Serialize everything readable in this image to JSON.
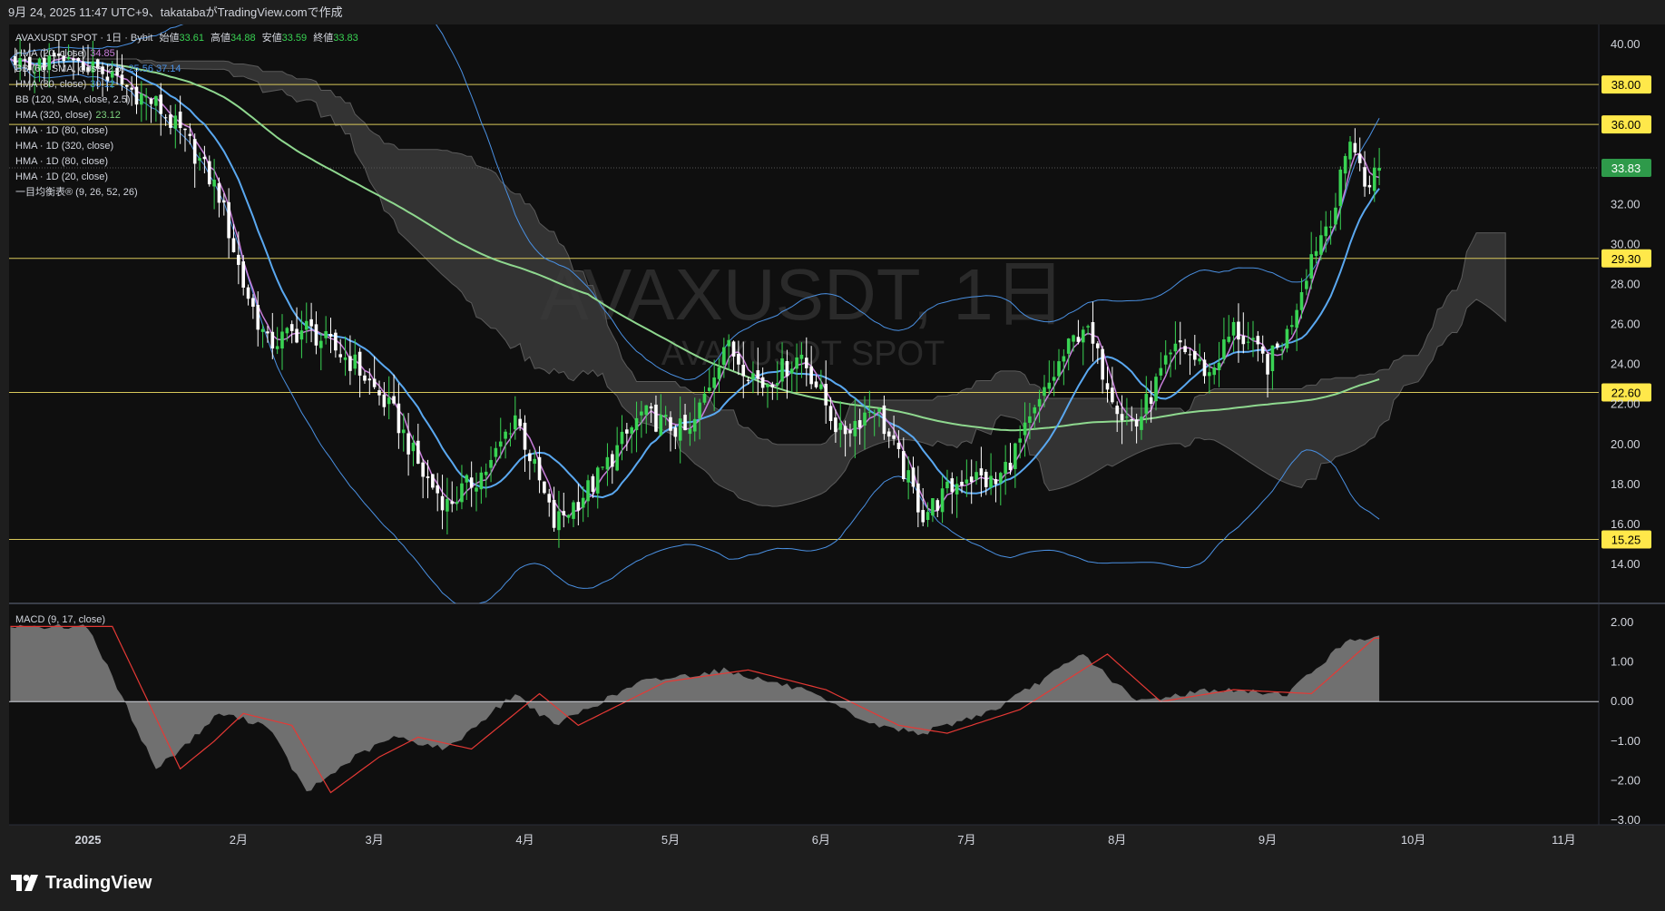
{
  "header": {
    "caption": "9月 24, 2025 11:47 UTC+9、takatabaがTradingView.comで作成"
  },
  "legend": {
    "symbol_line": {
      "label": "AVAXUSDT SPOT · 1日 · Bybit",
      "open_label": "始値",
      "open": "33.61",
      "high_label": "高値",
      "high": "34.88",
      "low_label": "安値",
      "low": "33.59",
      "close_label": "終値",
      "close": "33.83"
    },
    "indicators": [
      {
        "text": "HMA (20, close)",
        "value": "34.85",
        "color": "#c77dd9"
      },
      {
        "text": "BB (60, SMA, close, 2.5)",
        "value": "25.56  37.14",
        "color": "#4a90e2"
      },
      {
        "text": "HMA (80, close)",
        "value": "30.12",
        "color": "#4a90e2"
      },
      {
        "text": "BB (120, SMA, close, 2.5)",
        "value": "",
        "color": ""
      },
      {
        "text": "HMA (320, close)",
        "value": "23.12",
        "color": "#7ed37e"
      },
      {
        "text": "HMA · 1D (80, close)",
        "value": "",
        "color": ""
      },
      {
        "text": "HMA · 1D (320, close)",
        "value": "",
        "color": ""
      },
      {
        "text": "HMA · 1D (80, close)",
        "value": "",
        "color": ""
      },
      {
        "text": "HMA · 1D (20, close)",
        "value": "",
        "color": ""
      },
      {
        "text": "一目均衡表® (9, 26, 52, 26)",
        "value": "",
        "color": ""
      }
    ]
  },
  "watermark": {
    "main": "AVAXUSDT, 1日",
    "sub": "AVAXUSDT SPOT"
  },
  "price_axis": {
    "ticks": [
      "40.00",
      "32.00",
      "30.00",
      "28.00",
      "26.00",
      "24.00",
      "22.00",
      "20.00",
      "18.00",
      "16.00",
      "14.00"
    ]
  },
  "levels": [
    "38.00",
    "36.00",
    "29.30",
    "22.60",
    "15.25"
  ],
  "last_price": "33.83",
  "macd_pane": {
    "title": "MACD (9, 17, close)",
    "ticks": [
      "2.00",
      "1.00",
      "0.00",
      "−1.00",
      "−2.00",
      "−3.00"
    ]
  },
  "time_axis": {
    "labels": [
      "2025",
      "2月",
      "3月",
      "4月",
      "5月",
      "6月",
      "7月",
      "8月",
      "9月",
      "10月",
      "11月"
    ]
  },
  "footer": {
    "brand": "TradingView"
  },
  "colors": {
    "up": "#39d353",
    "down": "#ffffff",
    "level_line": "#d8c85a",
    "hma20": "#c77dd9",
    "hma80": "#5aa8f0",
    "hma320": "#8fd88f",
    "bb": "#4a90e2",
    "cloud": "#3a3a3a",
    "macd": "#e53935",
    "histogram": "#888888",
    "last_price_bg": "#2e9a4a"
  },
  "chart_data": [
    {
      "type": "candlestick",
      "title": "AVAXUSDT, 1日",
      "y_axis_ticks": [
        14,
        16,
        18,
        20,
        22,
        24,
        26,
        28,
        30,
        32,
        40
      ],
      "ylim": [
        13,
        41
      ],
      "x_labels": [
        "2025",
        "2月",
        "3月",
        "4月",
        "5月",
        "6月",
        "7月",
        "8月",
        "9月",
        "10月",
        "11月"
      ],
      "horizontal_levels": [
        38.0,
        36.0,
        29.3,
        22.6,
        15.25
      ],
      "last_close": 33.83,
      "last_bar": {
        "open": 33.61,
        "high": 34.88,
        "low": 33.59,
        "close": 33.83
      },
      "close_path": [
        {
          "date": "2025-01-01",
          "close": 39.0
        },
        {
          "date": "2025-01-15",
          "close": 37.0
        },
        {
          "date": "2025-01-22",
          "close": 35.0
        },
        {
          "date": "2025-01-28",
          "close": 32.5
        },
        {
          "date": "2025-02-02",
          "close": 28.0
        },
        {
          "date": "2025-02-07",
          "close": 25.0
        },
        {
          "date": "2025-02-15",
          "close": 25.8
        },
        {
          "date": "2025-02-25",
          "close": 24.0
        },
        {
          "date": "2025-03-05",
          "close": 21.5
        },
        {
          "date": "2025-03-11",
          "close": 18.5
        },
        {
          "date": "2025-03-16",
          "close": 17.0
        },
        {
          "date": "2025-03-25",
          "close": 19.0
        },
        {
          "date": "2025-03-30",
          "close": 21.5
        },
        {
          "date": "2025-04-07",
          "close": 16.0
        },
        {
          "date": "2025-04-15",
          "close": 18.0
        },
        {
          "date": "2025-04-25",
          "close": 21.5
        },
        {
          "date": "2025-05-05",
          "close": 20.5
        },
        {
          "date": "2025-05-12",
          "close": 25.0
        },
        {
          "date": "2025-05-20",
          "close": 23.0
        },
        {
          "date": "2025-05-28",
          "close": 24.5
        },
        {
          "date": "2025-06-05",
          "close": 20.5
        },
        {
          "date": "2025-06-12",
          "close": 22.0
        },
        {
          "date": "2025-06-22",
          "close": 16.5
        },
        {
          "date": "2025-07-01",
          "close": 18.5
        },
        {
          "date": "2025-07-07",
          "close": 18.0
        },
        {
          "date": "2025-07-14",
          "close": 21.0
        },
        {
          "date": "2025-07-20",
          "close": 24.0
        },
        {
          "date": "2025-07-25",
          "close": 26.0
        },
        {
          "date": "2025-08-02",
          "close": 21.5
        },
        {
          "date": "2025-08-05",
          "close": 21.0
        },
        {
          "date": "2025-08-10",
          "close": 23.5
        },
        {
          "date": "2025-08-14",
          "close": 25.0
        },
        {
          "date": "2025-08-20",
          "close": 23.5
        },
        {
          "date": "2025-08-25",
          "close": 25.8
        },
        {
          "date": "2025-09-01",
          "close": 24.0
        },
        {
          "date": "2025-09-05",
          "close": 25.5
        },
        {
          "date": "2025-09-10",
          "close": 29.5
        },
        {
          "date": "2025-09-15",
          "close": 32.0
        },
        {
          "date": "2025-09-18",
          "close": 35.5
        },
        {
          "date": "2025-09-21",
          "close": 33.0
        },
        {
          "date": "2025-09-24",
          "close": 33.83
        }
      ]
    },
    {
      "type": "line",
      "title": "MACD (9, 17, close)",
      "y_axis_ticks": [
        2,
        1,
        0,
        -1,
        -2,
        -3
      ],
      "ylim": [
        -3.05,
        2.2
      ],
      "series": [
        {
          "values_by_date": [
            {
              "date": "2025-01-01",
              "macd": 1.9
            },
            {
              "date": "2025-01-15",
              "macd": -1.7
            },
            {
              "date": "2025-01-22",
              "macd": -1.0
            },
            {
              "date": "2025-01-28",
              "macd": -0.3
            },
            {
              "date": "2025-02-07",
              "macd": -0.6
            },
            {
              "date": "2025-02-15",
              "macd": -2.3
            },
            {
              "date": "2025-02-25",
              "macd": -1.4
            },
            {
              "date": "2025-03-05",
              "macd": -0.9
            },
            {
              "date": "2025-03-16",
              "macd": -1.2
            },
            {
              "date": "2025-03-30",
              "macd": 0.2
            },
            {
              "date": "2025-04-07",
              "macd": -0.6
            },
            {
              "date": "2025-04-25",
              "macd": 0.5
            },
            {
              "date": "2025-05-12",
              "macd": 0.8
            },
            {
              "date": "2025-05-28",
              "macd": 0.3
            },
            {
              "date": "2025-06-12",
              "macd": -0.6
            },
            {
              "date": "2025-06-22",
              "macd": -0.8
            },
            {
              "date": "2025-07-07",
              "macd": -0.2
            },
            {
              "date": "2025-07-25",
              "macd": 1.2
            },
            {
              "date": "2025-08-05",
              "macd": 0.0
            },
            {
              "date": "2025-08-20",
              "macd": 0.3
            },
            {
              "date": "2025-09-05",
              "macd": 0.2
            },
            {
              "date": "2025-09-18",
              "macd": 1.6
            },
            {
              "date": "2025-09-24",
              "macd": 1.6
            }
          ]
        }
      ]
    }
  ]
}
